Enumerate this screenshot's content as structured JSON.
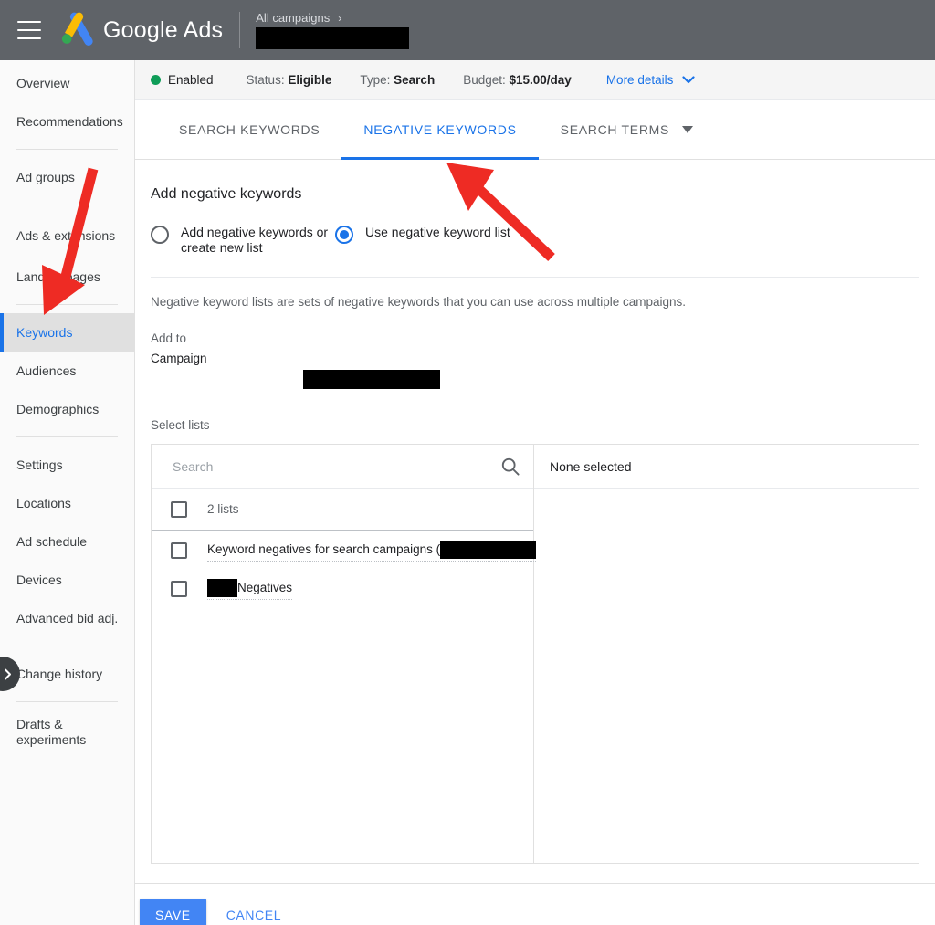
{
  "topbar": {
    "menu_icon": "hamburger-menu-icon",
    "brand": "Google Ads",
    "breadcrumb": "All campaigns",
    "breadcrumb_chevron": "›",
    "account_redacted": true
  },
  "sidebar": {
    "items": [
      {
        "label": "Overview",
        "active": false,
        "sep_after": false
      },
      {
        "label": "Recommendations",
        "active": false,
        "sep_after": true
      },
      {
        "label": "Ad groups",
        "active": false,
        "sep_after": true
      },
      {
        "label": "Ads & extensions",
        "active": false,
        "sep_after": false
      },
      {
        "label": "Landing pages",
        "active": false,
        "sep_after": true
      },
      {
        "label": "Keywords",
        "active": true,
        "sep_after": false
      },
      {
        "label": "Audiences",
        "active": false,
        "sep_after": false
      },
      {
        "label": "Demographics",
        "active": false,
        "sep_after": true
      },
      {
        "label": "Settings",
        "active": false,
        "sep_after": false
      },
      {
        "label": "Locations",
        "active": false,
        "sep_after": false
      },
      {
        "label": "Ad schedule",
        "active": false,
        "sep_after": false
      },
      {
        "label": "Devices",
        "active": false,
        "sep_after": false
      },
      {
        "label": "Advanced bid adj.",
        "active": false,
        "sep_after": true
      },
      {
        "label": "Change history",
        "active": false,
        "sep_after": true
      },
      {
        "label": "Drafts & experiments",
        "active": false,
        "sep_after": false
      }
    ],
    "expander_icon": "chevron-right-icon"
  },
  "status": {
    "state": "Enabled",
    "state_color": "#0f9d58",
    "status_key": "Status:",
    "status_value": "Eligible",
    "type_key": "Type:",
    "type_value": "Search",
    "budget_key": "Budget:",
    "budget_value": "$15.00/day",
    "more_details": "More details",
    "more_details_icon": "chevron-down-icon",
    "link_color": "#1a73e8"
  },
  "tabs": [
    {
      "label": "SEARCH KEYWORDS",
      "active": false,
      "has_caret": false
    },
    {
      "label": "NEGATIVE KEYWORDS",
      "active": true,
      "has_caret": false
    },
    {
      "label": "SEARCH TERMS",
      "active": false,
      "has_caret": true
    }
  ],
  "form": {
    "title": "Add negative keywords",
    "option_1": "Add negative keywords or create new list",
    "option_2": "Use negative keyword list",
    "selected_option": 2,
    "description": "Negative keyword lists are sets of negative keywords that you can use across multiple campaigns.",
    "add_to_label": "Add to",
    "campaign_label": "Campaign",
    "campaign_value_redacted": true,
    "select_lists_label": "Select lists"
  },
  "picker": {
    "search_placeholder": "Search",
    "search_value": "",
    "search_icon": "search-icon",
    "all_label": "2 lists",
    "all_checked": false,
    "rows": [
      {
        "label": "Keyword negatives for search campaigns (",
        "checked": false,
        "redact_after": true,
        "redact_before": false,
        "redact_width": 105
      },
      {
        "label": "Negatives",
        "checked": false,
        "redact_after": false,
        "redact_before": true,
        "redact_width": 33
      }
    ],
    "right_header": "None selected"
  },
  "footer": {
    "save_label": "SAVE",
    "cancel_label": "CANCEL",
    "save_color": "#4285f4"
  },
  "annotations": {
    "arrow_color": "#ee2b24",
    "arrow_1_target": "sidebar-item-keywords",
    "arrow_2_target": "tab-negative-keywords"
  }
}
